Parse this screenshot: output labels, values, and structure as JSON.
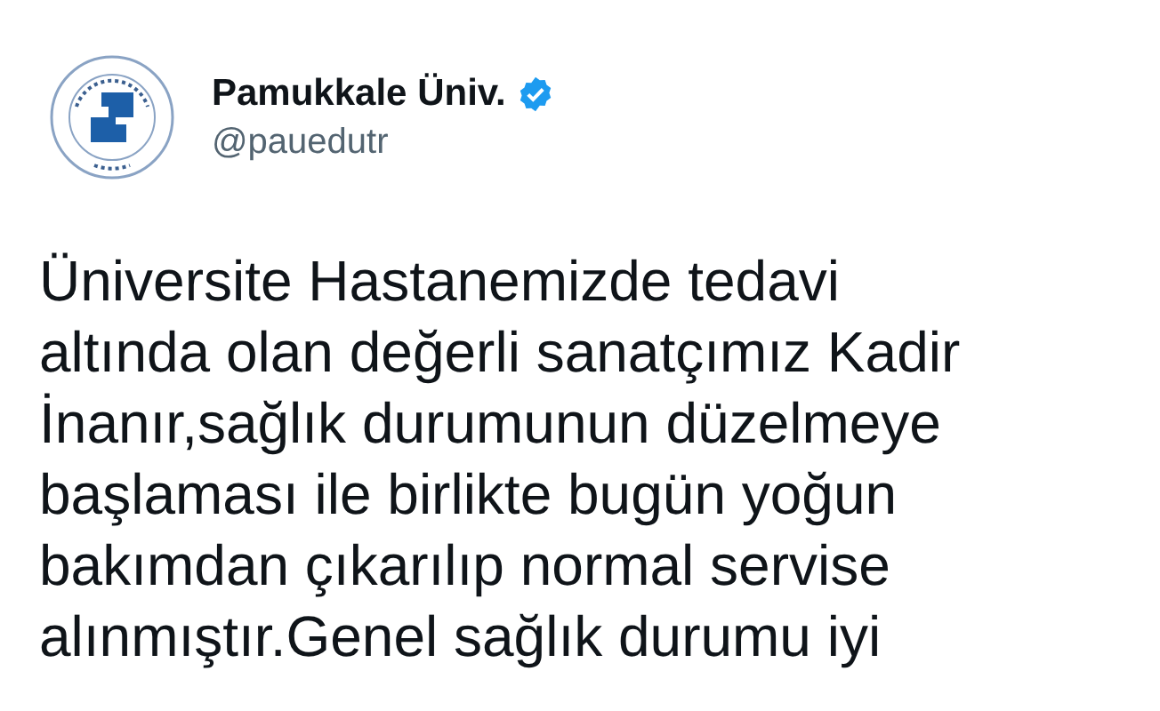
{
  "account": {
    "name": "Pamukkale Üniv.",
    "verified": true,
    "handle": "@pauedutr"
  },
  "tweet": {
    "lines": [
      "Üniversite Hastanemizde tedavi",
      "altında olan değerli sanatçımız Kadir",
      "İnanır,sağlık durumunun düzelmeye",
      "başlaması ile birlikte bugün yoğun",
      "bakımdan çıkarılıp normal servise",
      "alınmıştır.Genel sağlık durumu iyi"
    ]
  }
}
